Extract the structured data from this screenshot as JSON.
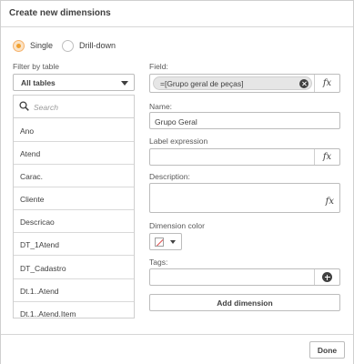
{
  "dialog": {
    "title": "Create new dimensions"
  },
  "mode": {
    "options": [
      "Single",
      "Drill-down"
    ],
    "selected": "Single"
  },
  "filter": {
    "label": "Filter by table",
    "selected": "All tables",
    "search_placeholder": "Search",
    "items": [
      "Ano",
      "Atend",
      "Carac.",
      "Cliente",
      "Descricao",
      "DT_1Atend",
      "DT_Cadastro",
      "Dt.1..Atend",
      "Dt.1..Atend.Item"
    ]
  },
  "form": {
    "field_label": "Field:",
    "field_value": "=[Grupo geral de peças]",
    "name_label": "Name:",
    "name_value": "Grupo Geral",
    "label_expression_label": "Label expression",
    "label_expression_value": "",
    "description_label": "Description:",
    "description_value": "",
    "dimension_color_label": "Dimension color",
    "tags_label": "Tags:",
    "fx_symbol": "fx",
    "add_dimension": "Add dimension"
  },
  "footer": {
    "done": "Done"
  }
}
